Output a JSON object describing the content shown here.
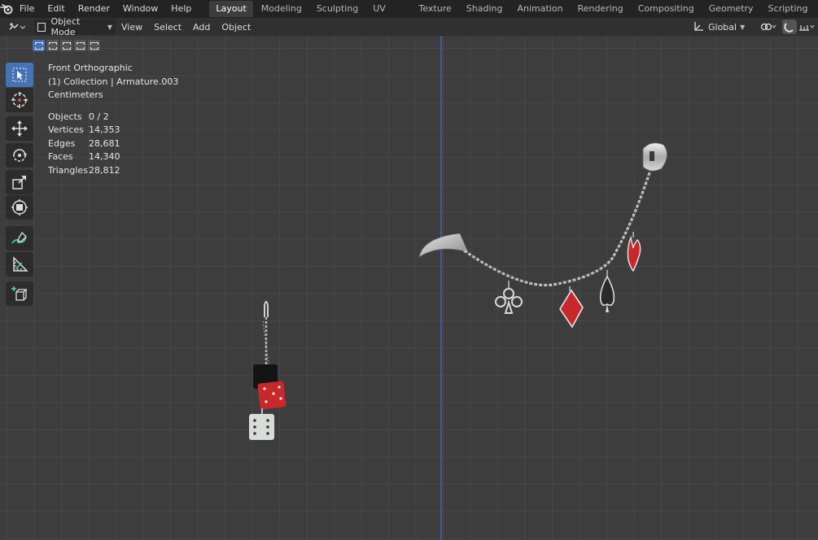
{
  "topbar": {
    "menus": [
      "File",
      "Edit",
      "Render",
      "Window",
      "Help"
    ],
    "workspaces": [
      "Layout",
      "Modeling",
      "Sculpting",
      "UV Editing",
      "Texture Paint",
      "Shading",
      "Animation",
      "Rendering",
      "Compositing",
      "Geometry Nodes",
      "Scripting"
    ],
    "active_workspace": "Layout",
    "add_tab": "+"
  },
  "header": {
    "mode": "Object Mode",
    "menus": [
      "View",
      "Select",
      "Add",
      "Object"
    ],
    "orientation": "Global"
  },
  "overlay": {
    "view": "Front Orthographic",
    "collection": "(1) Collection | Armature.003",
    "units": "Centimeters",
    "stats": [
      {
        "label": "Objects",
        "value": "0 / 2"
      },
      {
        "label": "Vertices",
        "value": "14,353"
      },
      {
        "label": "Edges",
        "value": "28,681"
      },
      {
        "label": "Faces",
        "value": "14,340"
      },
      {
        "label": "Triangles",
        "value": "28,812"
      }
    ]
  },
  "toolbar": {
    "tools": [
      "select-box-icon",
      "cursor-icon",
      "move-icon",
      "rotate-icon",
      "scale-icon",
      "transform-icon",
      "annotate-icon",
      "measure-icon",
      "add-cube-icon"
    ],
    "active": "select-box-icon"
  },
  "colors": {
    "accent": "#4772b3",
    "z_axis": "#3b5da8",
    "viewport_bg": "#3d3d3d",
    "grid": "#474747",
    "red_enamel": "#c8282b"
  }
}
